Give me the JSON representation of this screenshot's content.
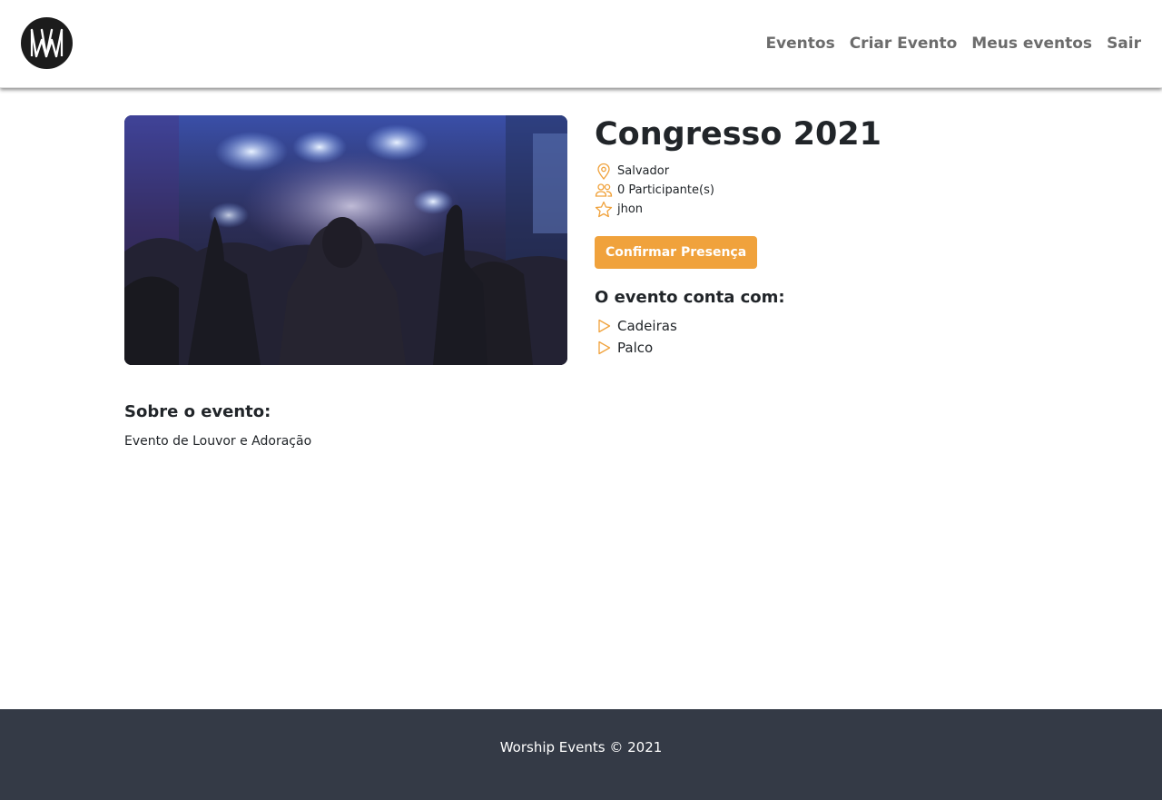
{
  "header": {
    "logo_icon": "ww-monogram-logo",
    "nav": [
      {
        "label": "Eventos"
      },
      {
        "label": "Criar Evento"
      },
      {
        "label": "Meus eventos"
      },
      {
        "label": "Sair"
      }
    ]
  },
  "event": {
    "title": "Congresso 2021",
    "image_icon": "concert-crowd-photo",
    "location": "Salvador",
    "participants": "0 Participante(s)",
    "owner": "jhon",
    "confirm_label": "Confirmar Presença",
    "features_title": "O evento conta com:",
    "features": [
      {
        "label": "Cadeiras"
      },
      {
        "label": "Palco"
      }
    ],
    "about_title": "Sobre o evento:",
    "about_text": "Evento de Louvor e Adoração"
  },
  "footer": {
    "text": "Worship Events © 2021"
  },
  "colors": {
    "accent": "#f0a23c",
    "footer_bg": "#343a46",
    "nav_text": "#6c6c6c"
  }
}
